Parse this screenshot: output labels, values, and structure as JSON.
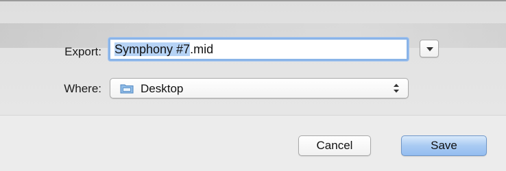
{
  "dialog": {
    "export_label": "Export:",
    "filename_selected": "Symphony #7",
    "filename_extension": ".mid",
    "where_label": "Where:",
    "location": "Desktop",
    "folder_icon": "folder-icon",
    "expand_icon": "disclosure-triangle-icon",
    "stepper_icon": "up-down-arrows-icon",
    "cancel_label": "Cancel",
    "save_label": "Save"
  },
  "colors": {
    "selection": "#b6d3f5",
    "focus_ring": "#8ab4e8",
    "default_button": "#a9cbf2"
  }
}
